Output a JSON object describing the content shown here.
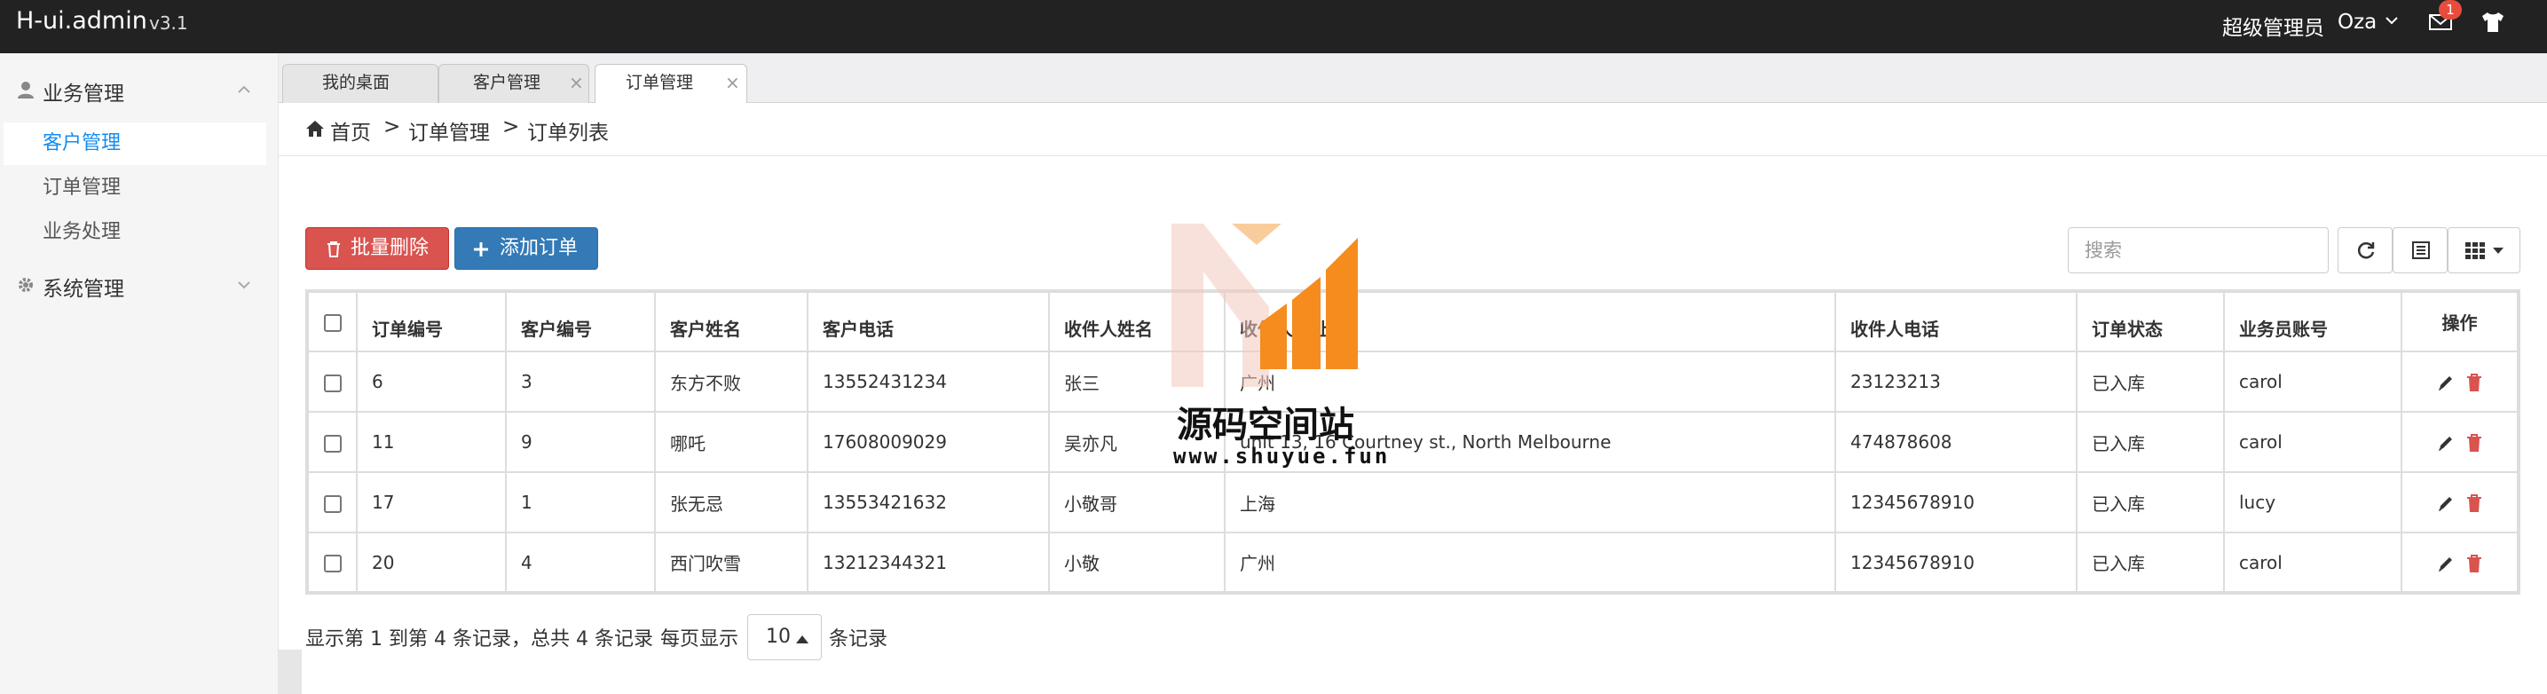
{
  "app": {
    "brand": "H-ui.admin",
    "version": "v3.1"
  },
  "topbar": {
    "role": "超级管理员",
    "user": "Oza",
    "mail_badge": "1"
  },
  "sidebar": {
    "groups": [
      {
        "label": "业务管理",
        "icon": "user-icon",
        "items": [
          "客户管理",
          "订单管理",
          "业务处理"
        ]
      },
      {
        "label": "系统管理",
        "icon": "gear-icon",
        "items": []
      }
    ],
    "active_item": "客户管理"
  },
  "tabs": [
    {
      "label": "我的桌面",
      "closable": false,
      "active": false
    },
    {
      "label": "客户管理",
      "closable": true,
      "active": false
    },
    {
      "label": "订单管理",
      "closable": true,
      "active": true
    }
  ],
  "breadcrumb": {
    "home": "首页",
    "sep": ">",
    "level1": "订单管理",
    "level2": "订单列表"
  },
  "toolbar": {
    "batch_delete": "批量删除",
    "add_order": "添加订单",
    "search_placeholder": "搜索"
  },
  "table": {
    "columns": [
      "订单编号",
      "客户编号",
      "客户姓名",
      "客户电话",
      "收件人姓名",
      "收件人地址",
      "收件人电话",
      "订单状态",
      "业务员账号",
      "操作"
    ],
    "rows": [
      [
        "6",
        "3",
        "东方不败",
        "13552431234",
        "张三",
        "广州",
        "23123213",
        "已入库",
        "carol"
      ],
      [
        "11",
        "9",
        "哪吒",
        "17608009029",
        "吴亦凡",
        "unit 13, 16 Courtney st., North Melbourne",
        "474878608",
        "已入库",
        "carol"
      ],
      [
        "17",
        "1",
        "张无忌",
        "13553421632",
        "小敬哥",
        "上海",
        "12345678910",
        "已入库",
        "lucy"
      ],
      [
        "20",
        "4",
        "西门吹雪",
        "13212344321",
        "小敬",
        "广州",
        "12345678910",
        "已入库",
        "carol"
      ]
    ]
  },
  "pagination": {
    "info": "显示第 1 到第 4 条记录，总共 4 条记录",
    "per_page_label": "每页显示",
    "per_page": "10",
    "suffix": "条记录"
  },
  "watermark": {
    "title": "源码空间站",
    "url": "www.shuyue.fun"
  },
  "colors": {
    "topbar": "#222222",
    "danger": "#d9534f",
    "primary": "#337ab7",
    "active_link": "#148cf1",
    "watermark_orange": "#f68b1e"
  }
}
